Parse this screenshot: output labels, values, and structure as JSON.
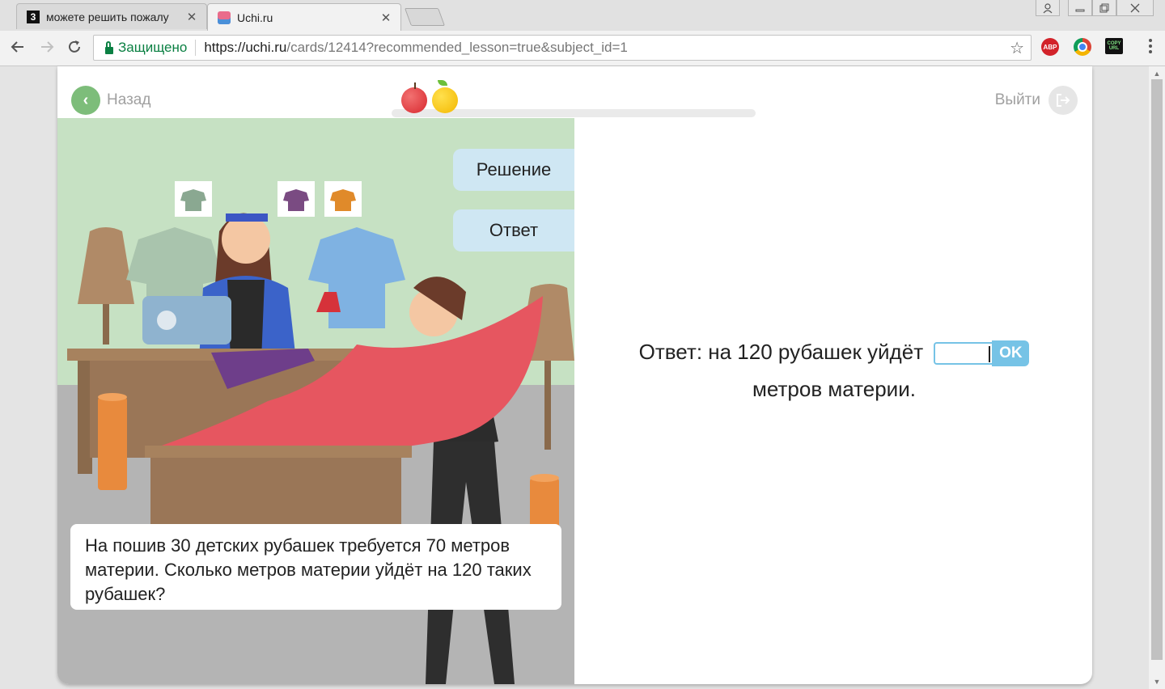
{
  "browser": {
    "tabs": [
      {
        "title": "можете решить пожалу",
        "favicon": "3",
        "active": false
      },
      {
        "title": "Uchi.ru",
        "favicon": "uchi-icon",
        "active": true
      }
    ],
    "security_label": "Защищено",
    "url_host": "https://uchi.ru",
    "url_rest": "/cards/12414?recommended_lesson=true&subject_id=1",
    "extensions": [
      "ABP",
      "COPY URL"
    ]
  },
  "page": {
    "back_label": "Назад",
    "exit_label": "Выйти",
    "solution_label": "Решение",
    "answer_tab_label": "Ответ",
    "problem_text": "На пошив 30 детских рубашек требуется 70 метров материи. Сколько метров материи уйдёт на 120 таких рубашек?",
    "answer_prefix": "Ответ: на 120 рубашек уйдёт",
    "answer_suffix": "метров материи.",
    "ok_label": "OK",
    "answer_value": "",
    "progress_fruits": [
      "apple-icon",
      "orange-icon"
    ]
  },
  "colors": {
    "accent_green": "#7dbd7a",
    "input_blue": "#76c3e6",
    "side_button": "#cfe7f3"
  }
}
